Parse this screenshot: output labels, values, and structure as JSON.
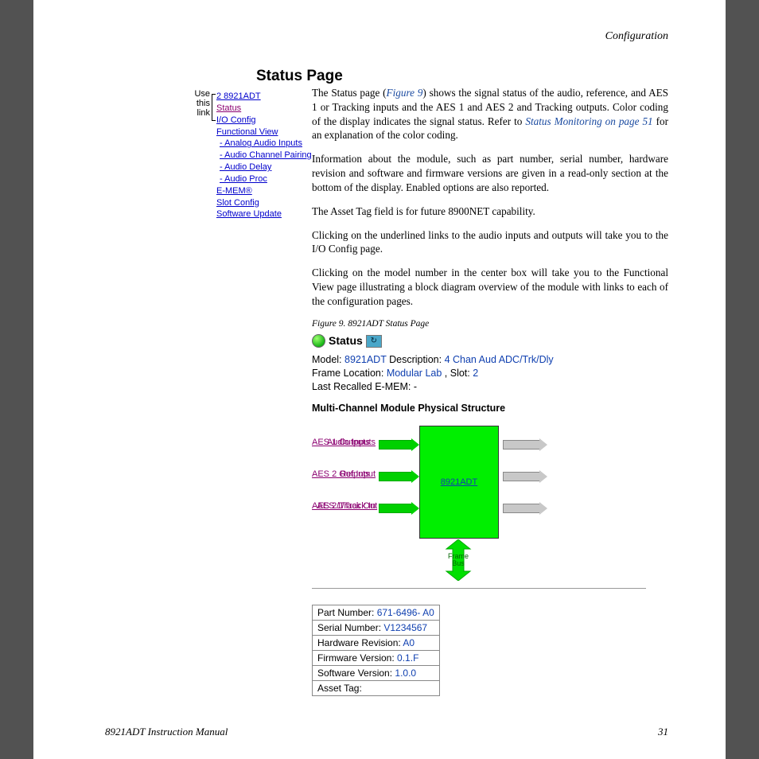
{
  "header": {
    "section": "Configuration"
  },
  "title": "Status Page",
  "nav": {
    "hint": "Use this link",
    "items": [
      {
        "label": "2 8921ADT",
        "cls": ""
      },
      {
        "label": "Status",
        "cls": "status-link"
      },
      {
        "label": "I/O Config",
        "cls": ""
      },
      {
        "label": "Functional View",
        "cls": ""
      },
      {
        "label": "- Analog Audio Inputs",
        "cls": "dash"
      },
      {
        "label": "- Audio Channel Pairing",
        "cls": "dash"
      },
      {
        "label": "- Audio Delay",
        "cls": "dash"
      },
      {
        "label": "- Audio Proc",
        "cls": "dash"
      },
      {
        "label": "E-MEM®",
        "cls": ""
      },
      {
        "label": "Slot Config",
        "cls": ""
      },
      {
        "label": "Software Update",
        "cls": ""
      }
    ]
  },
  "paras": {
    "p1a": "The Status page (",
    "p1_fig": "Figure 9",
    "p1b": ") shows the signal status of the audio, reference, and AES 1 or Tracking inputs and the AES 1 and AES 2 and Tracking outputs. Color coding of the display indicates the signal status. Refer to ",
    "p1_xref": "Status Monitoring",
    "p1_on": " on page 51",
    "p1c": " for an explanation of the color coding.",
    "p2": "Information about the module, such as part number, serial number, hardware revision and software and firmware versions are given in a read-only section at the bottom of the display. Enabled options are also reported.",
    "p3": "The Asset Tag field is for future 8900NET capability.",
    "p4": "Clicking on the underlined links to the audio inputs and outputs will take you to the I/O Config page.",
    "p5": "Clicking on the model number in the center box will take you to the Functional View page illustrating a block diagram overview of the module with links to each of the configuration pages."
  },
  "figcaption": "Figure 9.  8921ADT Status Page",
  "status": {
    "heading": "Status",
    "model_lbl": "Model:",
    "model_val": "8921ADT",
    "desc_lbl": "Description:",
    "desc_val": "4 Chan Aud ADC/Trk/Dly",
    "frame_lbl": "Frame Location:",
    "frame_val": "Modular Lab",
    "slot_lbl": ", Slot:",
    "slot_val": "2",
    "emem_lbl": "Last Recalled E-MEM:",
    "emem_val": "-",
    "mcmps": "Multi-Channel Module Physical Structure",
    "module": "8921ADT",
    "inputs": [
      "Audio Inputs",
      "Ref Input",
      "AES 1/Track In"
    ],
    "outputs": [
      "AES 1 Outputs",
      "AES 2 Outputs",
      "AES 2/Track Out"
    ],
    "frame_bus": "Frame Bus"
  },
  "info_rows": [
    {
      "label": "Part Number:",
      "value": "671-6496- A0"
    },
    {
      "label": "Serial Number:",
      "value": "V1234567"
    },
    {
      "label": "Hardware Revision:",
      "value": "A0"
    },
    {
      "label": "Firmware Version:",
      "value": "0.1.F"
    },
    {
      "label": "Software Version:",
      "value": "1.0.0"
    },
    {
      "label": "Asset Tag:",
      "value": ""
    }
  ],
  "footer": {
    "left": "8921ADT Instruction Manual",
    "right": "31"
  }
}
